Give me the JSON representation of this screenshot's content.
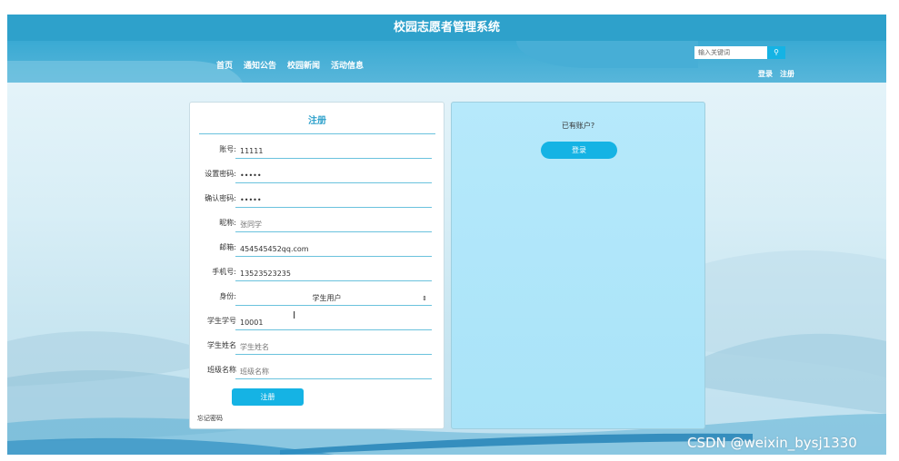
{
  "header": {
    "title": "校园志愿者管理系统",
    "nav": [
      "首页",
      "通知公告",
      "校园新闻",
      "活动信息"
    ],
    "search_placeholder": "输入关键词",
    "search_icon": "search-icon",
    "login_link": "登录",
    "register_link": "注册"
  },
  "form": {
    "title": "注册",
    "fields": [
      {
        "label": "账号:",
        "value": "11111"
      },
      {
        "label": "设置密码:",
        "value": "•••••"
      },
      {
        "label": "确认密码:",
        "value": "•••••"
      },
      {
        "label": "昵称:",
        "value": "张同学"
      },
      {
        "label": "邮箱:",
        "value": "454545452qq.com"
      },
      {
        "label": "手机号:",
        "value": "13523523235"
      },
      {
        "label": "身份:",
        "value": "学生用户"
      },
      {
        "label": "学生学号",
        "value": "10001"
      },
      {
        "label": "学生姓名",
        "placeholder": "学生姓名"
      },
      {
        "label": "班级名称",
        "placeholder": "班级名称"
      }
    ],
    "submit_label": "注册",
    "forgot_label": "忘记密码"
  },
  "side": {
    "prompt": "已有账户?",
    "login_label": "登录"
  },
  "watermark": "CSDN @weixin_bysj1330"
}
